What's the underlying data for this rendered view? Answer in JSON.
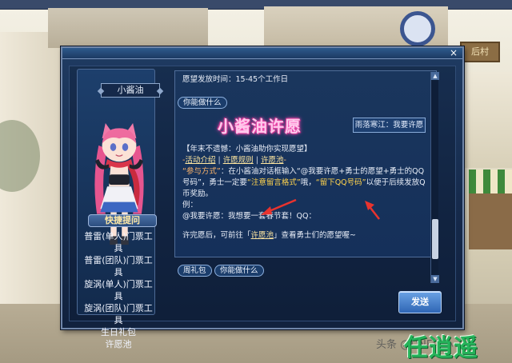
{
  "background": {
    "shop_sign": "后村"
  },
  "dialog": {
    "close_icon": "×",
    "character": {
      "name": "小酱油"
    },
    "quick_menu": {
      "title": "快捷提问",
      "items": [
        "普雷(单人)门票工具",
        "普雷(团队)门票工具",
        "旋涡(单人)门票工具",
        "旋涡(团队)门票工具",
        "生日礼包",
        "许愿池"
      ]
    },
    "content": {
      "top_line": "愿望发放时间：15-45个工作日",
      "top_button": "你能做什么",
      "headline": "小酱油许愿",
      "side_button": "雨落寒江：我要许愿",
      "lines": {
        "l1": "【年末不遗憾：小酱油助你实现愿望】",
        "l2_prefix": "-",
        "l2_link1": "活动介绍",
        "l2_sep1": " | ",
        "l2_link2": "许愿规则",
        "l2_sep2": " | ",
        "l2_link3": "许愿池",
        "l2_suffix": "-",
        "l3_label": "“参与方式”",
        "l3_text": "：在小酱油对话框输入“@我要许愿+勇士的愿望+勇士的QQ号码”，勇士一定要",
        "l3_hl1": "“注意留言格式”",
        "l3_mid": "哦，",
        "l3_hl2": "“留下QQ号码”",
        "l3_tail": "以便于后续发放Q币奖励。",
        "l4": "例：",
        "l5": "@我要许愿：我想要一套春节套！QQ：",
        "l6_prefix": "许完愿后，可前往「",
        "l6_link": "许愿池",
        "l6_suffix": "」查看勇士们的愿望喔~"
      }
    },
    "bottom_buttons": {
      "gift": "周礼包",
      "what": "你能做什么"
    },
    "send_button": "发送"
  },
  "watermark": {
    "text": "头条 @DNF中心",
    "brand": "任逍遥"
  },
  "colors": {
    "headline_pink": "#ffc9ec",
    "highlight_orange": "#ffb56a",
    "highlight_yellow": "#ffd34d",
    "arrow_red": "#e8332e",
    "brand_green": "#25b35a"
  }
}
